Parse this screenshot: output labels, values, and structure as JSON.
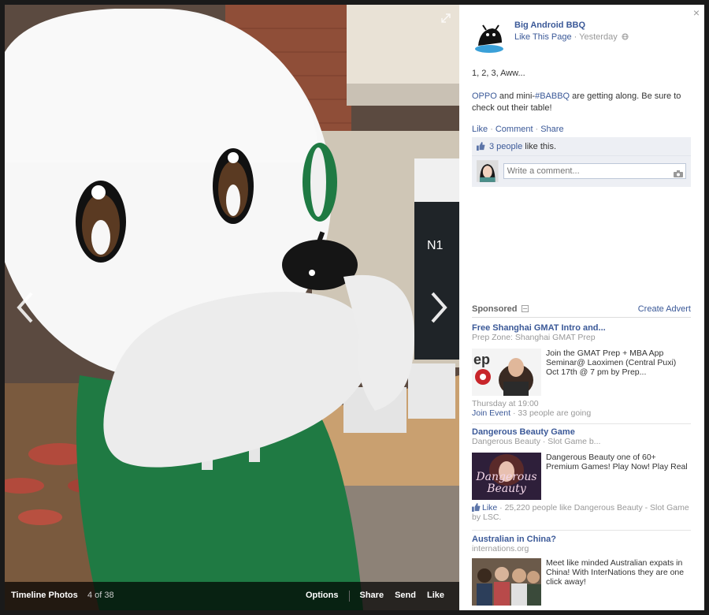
{
  "photo_bar": {
    "album": "Timeline Photos",
    "counter": "4 of 38",
    "actions": [
      "Options",
      "Share",
      "Send",
      "Like"
    ]
  },
  "page": {
    "name": "Big Android BBQ",
    "like_page": "Like This Page",
    "time": "Yesterday"
  },
  "post": {
    "line1": "1, 2, 3, Aww...",
    "mention": "OPPO",
    "text_mid": " and mini-",
    "hashtag": "#BABBQ",
    "text_end": " are getting along. Be sure to check out their table!"
  },
  "post_actions": {
    "like": "Like",
    "comment": "Comment",
    "share": "Share"
  },
  "likes": {
    "count_link": "3 people",
    "suffix": " like this."
  },
  "comment_input": {
    "placeholder": "Write a comment..."
  },
  "sponsored": {
    "label": "Sponsored",
    "create": "Create Advert",
    "ads": [
      {
        "title": "Free Shanghai GMAT Intro and...",
        "domain": "Prep Zone: Shanghai GMAT Prep",
        "body": "Join the GMAT Prep + MBA App Seminar@ Laoximen (Central Puxi) Oct 17th @ 7 pm by Prep...",
        "foot_time": "Thursday at 19:00",
        "foot_link": "Join Event",
        "foot_text": " · 33 people are going"
      },
      {
        "title": "Dangerous Beauty Game",
        "domain": "Dangerous Beauty · Slot Game b...",
        "body": "Dangerous Beauty one of 60+ Premium Games! Play Now! Play Real",
        "img_text": "Dangerous Beauty",
        "foot_link": "Like",
        "foot_text": " · 25,220 people like Dangerous Beauty - Slot Game by LSC."
      },
      {
        "title": "Australian in China?",
        "domain": "internations.org",
        "body": "Meet like minded Australian expats in China! With InterNations they are one click away!"
      }
    ]
  },
  "colors": {
    "link": "#3b5998",
    "ufi_bg": "#edeff4",
    "mascot_green": "#1f7a43"
  }
}
